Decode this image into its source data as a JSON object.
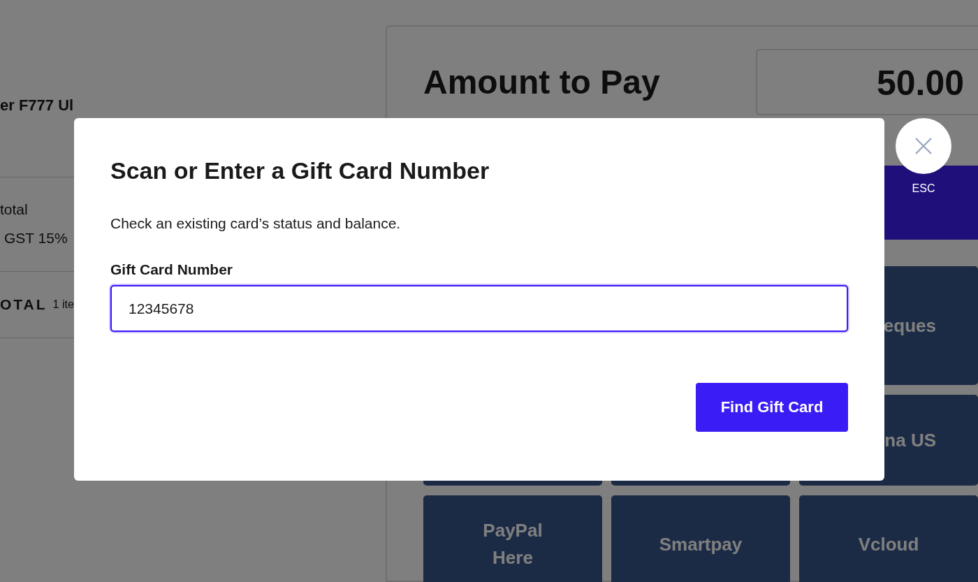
{
  "order": {
    "item_name": "er F777 Ul",
    "summary": [
      {
        "label": "total"
      },
      {
        "label": "GST 15%"
      }
    ],
    "total": {
      "label": "OTAL",
      "count": "1 ite"
    }
  },
  "payment": {
    "title": "Amount to Pay",
    "amount": "50.00",
    "tile_rows": [
      {
        "tiles": [
          {
            "label": "eques"
          }
        ]
      },
      {
        "tiles": [
          {
            "label": "na US"
          }
        ]
      },
      {
        "tiles": [
          {
            "label": "PayPal Here"
          },
          {
            "label": "Smartpay"
          },
          {
            "label": "Vcloud"
          }
        ]
      }
    ]
  },
  "modal": {
    "title": "Scan or Enter a Gift Card Number",
    "description": "Check an existing card’s status and balance.",
    "field": {
      "label": "Gift Card Number",
      "value": "12345678"
    },
    "button": "Find Gift Card",
    "close_hint": "ESC"
  }
}
